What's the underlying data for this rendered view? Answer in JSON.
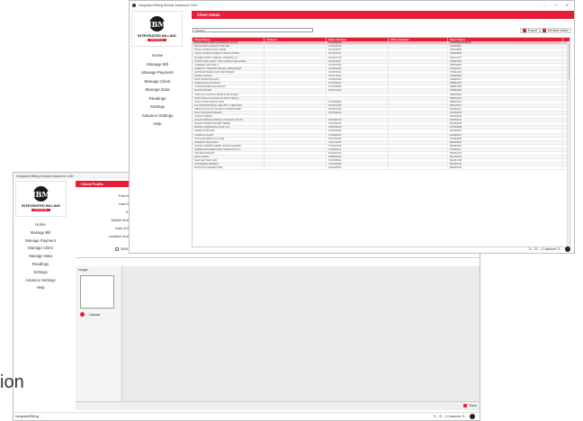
{
  "app_title": "Integrated Billing Module Advanced 1400",
  "logo": {
    "mark": "IBM",
    "name": "INTEGRATED BILLING",
    "sub": "MODULE"
  },
  "sidebar_items": [
    "Home",
    "Manage Bill",
    "Manage Payment",
    "Manage Client",
    "Manage Data",
    "Readings",
    "Settings",
    "Advance Settings",
    "Help"
  ],
  "front": {
    "header": "Client Status",
    "search_value": "Search",
    "export_label": "Export",
    "member_label": "Member Active",
    "columns": [
      "Client Name",
      "Address",
      "Meter Number",
      "Office Number",
      "Meter Name"
    ],
    "rows": [
      [
        "MOHAMMED SIMON RODERICK AFLAN",
        "",
        "9712029489",
        "",
        "200945963/MO500D"
      ],
      [
        "MANIJUNATH MADHAV KRITHIK",
        "",
        "9713435346",
        "",
        "200009867"
      ],
      [
        "RAHUL SAMIR RAHUL SAMIL",
        "",
        "9713343777",
        "",
        "200079908"
      ],
      [
        "VINOLA NOMIN ALMEIDA VINOLA NOMIN",
        "",
        "9713266797",
        "",
        "200849825"
      ],
      [
        "MAHER AHMET SAMINAL TRADING LLC",
        "",
        "9712057749",
        "",
        "200172707"
      ],
      [
        "SAYANT SELLADIAL YUKO ASSNAT SELLADIAL",
        "",
        "9712201967",
        "",
        "200345463"
      ],
      [
        "CHARDEL NIR KHALIL",
        "",
        "9712877760",
        "",
        "200578864"
      ],
      [
        "ALBERTO STEPHEN MIGUEL FERNANDEZ",
        "",
        "9712069049",
        "",
        "200450614"
      ],
      [
        "ANTONIO PRAMO ANTONIO PRAMO",
        "",
        "9712579231",
        "",
        "678322134"
      ],
      [
        "DANIEL DANIJA",
        "",
        "9712779613",
        "",
        "200838988"
      ],
      [
        "HANI NASRIN DAHLEY",
        "",
        "9712927284",
        "",
        "200800627"
      ],
      [
        "AIMMA KHALID KHALID",
        "",
        "9712363444",
        "",
        "388087651"
      ],
      [
        "CONSTANTINE ELEONOLUS",
        "",
        "9712065680",
        "",
        "388087658"
      ],
      [
        "MOAWIA BADRI",
        "",
        "9711614230",
        "",
        "388082988"
      ],
      [
        "CARLOS AUGUSTO BASTOS PETTENGI",
        "",
        "",
        "",
        "388046094"
      ],
      [
        "SAMY Mohammed Rahmed SAMY Moham",
        "",
        "",
        "",
        "388052434"
      ],
      [
        "Rizak Al Shah Rizak Al Shah",
        "",
        "9712089083",
        "",
        "388009447"
      ],
      [
        "GIF INTERNATIONAL SECURITY SERVICES",
        "",
        "9712057094",
        "",
        "385175547"
      ],
      [
        "ABDULLAH HILAL SALAM AL MADANI MED",
        "",
        "9712672140",
        "",
        "200492113"
      ],
      [
        "RAJU SADHAM SADHAM",
        "",
        "9712189949",
        "",
        "200436529"
      ],
      [
        "KHALID SHAHID",
        "",
        "",
        "",
        "200449236"
      ],
      [
        "JOHAN MANUEL MORILLO POLANIA JOHAN",
        "",
        "9710486712",
        "",
        "862250144"
      ],
      [
        "SHAHID SEMEN SHAHID SEMEN",
        "",
        "9711384276",
        "",
        "862250048"
      ],
      [
        "MADSH HAMADULAH DULF LLC",
        "",
        "9709095199",
        "",
        "617836689"
      ],
      [
        "KARIM NAJMUDIN",
        "",
        "9712515649",
        "",
        "862255324"
      ],
      [
        "TALEB AL HILABY",
        "",
        "9710268324",
        "",
        "200495022"
      ],
      [
        "SATTHAM ABDULLAH NAIR",
        "",
        "9712165049",
        "",
        "200469548"
      ],
      [
        "ETIENNE PROVANCE",
        "",
        "9710731505",
        "",
        "862255426"
      ],
      [
        "JUNAID SHAMIM AHMED JUNAID SHAMIM",
        "",
        "9711524913",
        "",
        "862255292"
      ],
      [
        "AHMED MOHAMED SAMY MAHMOUD ALY",
        "",
        "9709662113",
        "",
        "678322347"
      ],
      [
        "CELINE RASHANT",
        "",
        "9712002440",
        "",
        "862251240"
      ],
      [
        "RAHLA SABA",
        "",
        "9708065223",
        "",
        "862255345"
      ],
      [
        "Nadir Hahl Nadir Hahl",
        "",
        "9710689534",
        "",
        "862251798"
      ],
      [
        "CATHERINE HERMES",
        "",
        "9712186492",
        "",
        "862255149"
      ],
      [
        "FRANCOIS HENDRIK NEL",
        "",
        "9710226933",
        "",
        "862255040"
      ]
    ],
    "status_text": "Ti... 2l... | Customer S..."
  },
  "back": {
    "header": "Client Profile",
    "fields": [
      "First Nat",
      "Last Nat",
      "Em",
      "Mobile Numb",
      "Date of Bir",
      "Landline Numb",
      "Title"
    ],
    "landline_value": "IntegratedBilling...",
    "options": [
      "SMS",
      "Email",
      "WhatsApp"
    ],
    "image_label": "Image",
    "upload_label": "Upload",
    "save_label": "Save",
    "status_left": "IntegratedBilling...",
    "status_right": "Ti... 2l... | Customer S..."
  },
  "fragment_text": "ion"
}
